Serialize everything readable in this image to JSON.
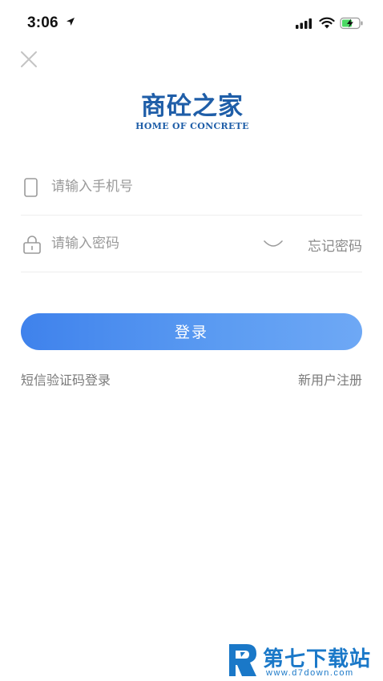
{
  "status_bar": {
    "time": "3:06",
    "icons": [
      "location-arrow-icon",
      "signal-icon",
      "wifi-icon",
      "battery-charging-icon"
    ]
  },
  "header": {
    "close_icon": "close-icon"
  },
  "logo": {
    "title_cn": "商砼之家",
    "title_en": "HOME OF CONCRETE"
  },
  "form": {
    "phone": {
      "placeholder": "请输入手机号",
      "value": "",
      "icon": "phone-icon"
    },
    "password": {
      "placeholder": "请输入密码",
      "value": "",
      "icon": "lock-icon",
      "toggle_icon": "eye-closed-icon",
      "forgot_label": "忘记密码"
    },
    "login_label": "登录"
  },
  "links": {
    "sms_login": "短信验证码登录",
    "register": "新用户注册"
  },
  "watermark": {
    "title": "第七下载站",
    "url": "www.d7down.com"
  },
  "colors": {
    "accent": "#3f82ec",
    "logo": "#1f5ea8",
    "watermark": "#1a78c8"
  }
}
